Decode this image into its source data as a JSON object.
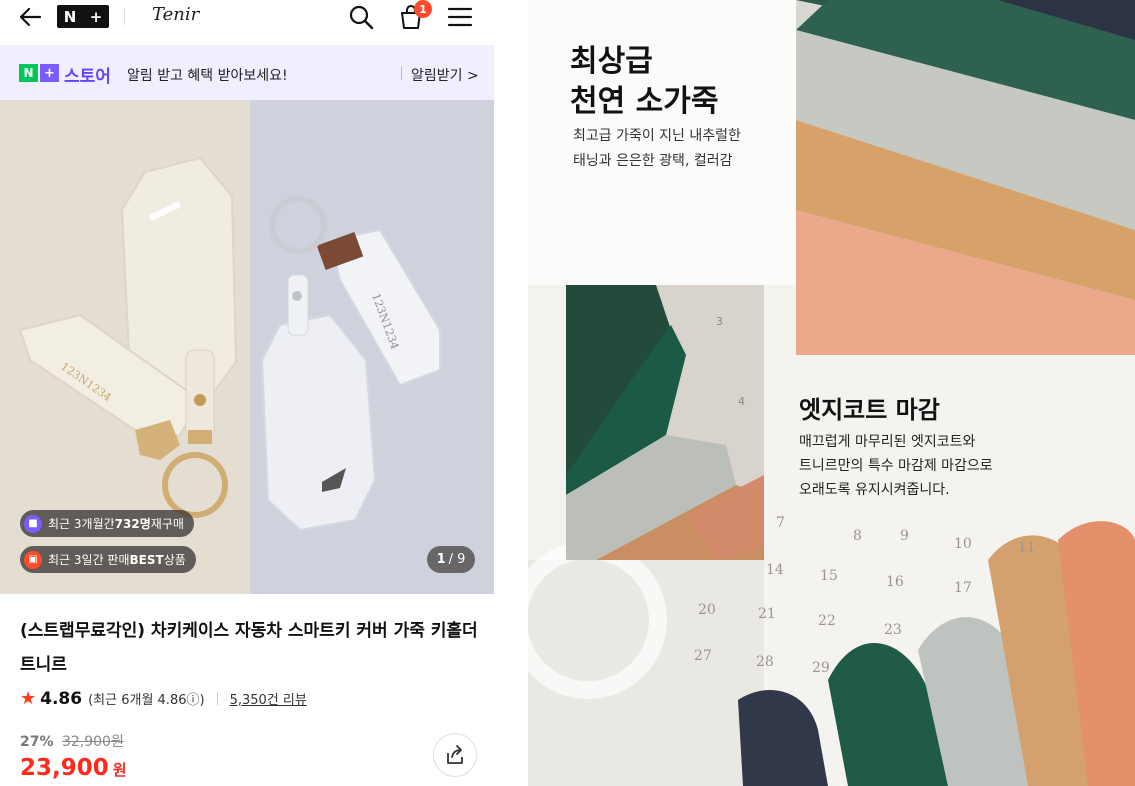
{
  "header": {
    "logo_left": "N",
    "logo_right": "+",
    "brand": "Tenir",
    "cart_badge": "1"
  },
  "notice": {
    "n": "N",
    "plus": "+",
    "store": "스토어",
    "message": "알림 받고 혜택 받아보세요!",
    "button": "알림받기 >"
  },
  "product": {
    "badge1_prefix": "최근 3개월간 ",
    "badge1_bold": "732명",
    "badge1_suffix": " 재구매",
    "badge2_prefix": "최근 3일간 판매 ",
    "badge2_bold": "BEST",
    "badge2_suffix": " 상품",
    "page_current": "1",
    "page_total": "/ 9",
    "title": "(스트랩무료각인) 차키케이스 자동차 스마트키 커버 가죽 키홀더 트니르",
    "rating": "4.86",
    "rating_note": "(최근 6개월 4.86ⓘ)",
    "reviews": "5,350건 리뷰",
    "discount": "27%",
    "original_price": "32,900원",
    "price": "23,900",
    "price_unit": "원"
  },
  "detail": {
    "heading1_line1": "최상급",
    "heading1_line2": "천연 소가죽",
    "text1_line1": "최고급 가죽이 지닌 내추럴한",
    "text1_line2": "태닝과 은은한 광택, 컬러감",
    "heading2": "엣지코트 마감",
    "text2_line1": "매끄럽게 마무리된 엣지코트와",
    "text2_line2": "트니르만의 특수 마감제 마감으로",
    "text2_line3": "오래도록 유지시켜줍니다.",
    "calendar_numbers": [
      "3",
      "4",
      "7",
      "8",
      "9",
      "10",
      "11",
      "14",
      "15",
      "16",
      "17",
      "20",
      "21",
      "22",
      "23",
      "27",
      "28",
      "29"
    ]
  },
  "colors": {
    "accent": "#6244ff",
    "price_red": "#ff2a1d",
    "store_green": "#03c75a"
  }
}
